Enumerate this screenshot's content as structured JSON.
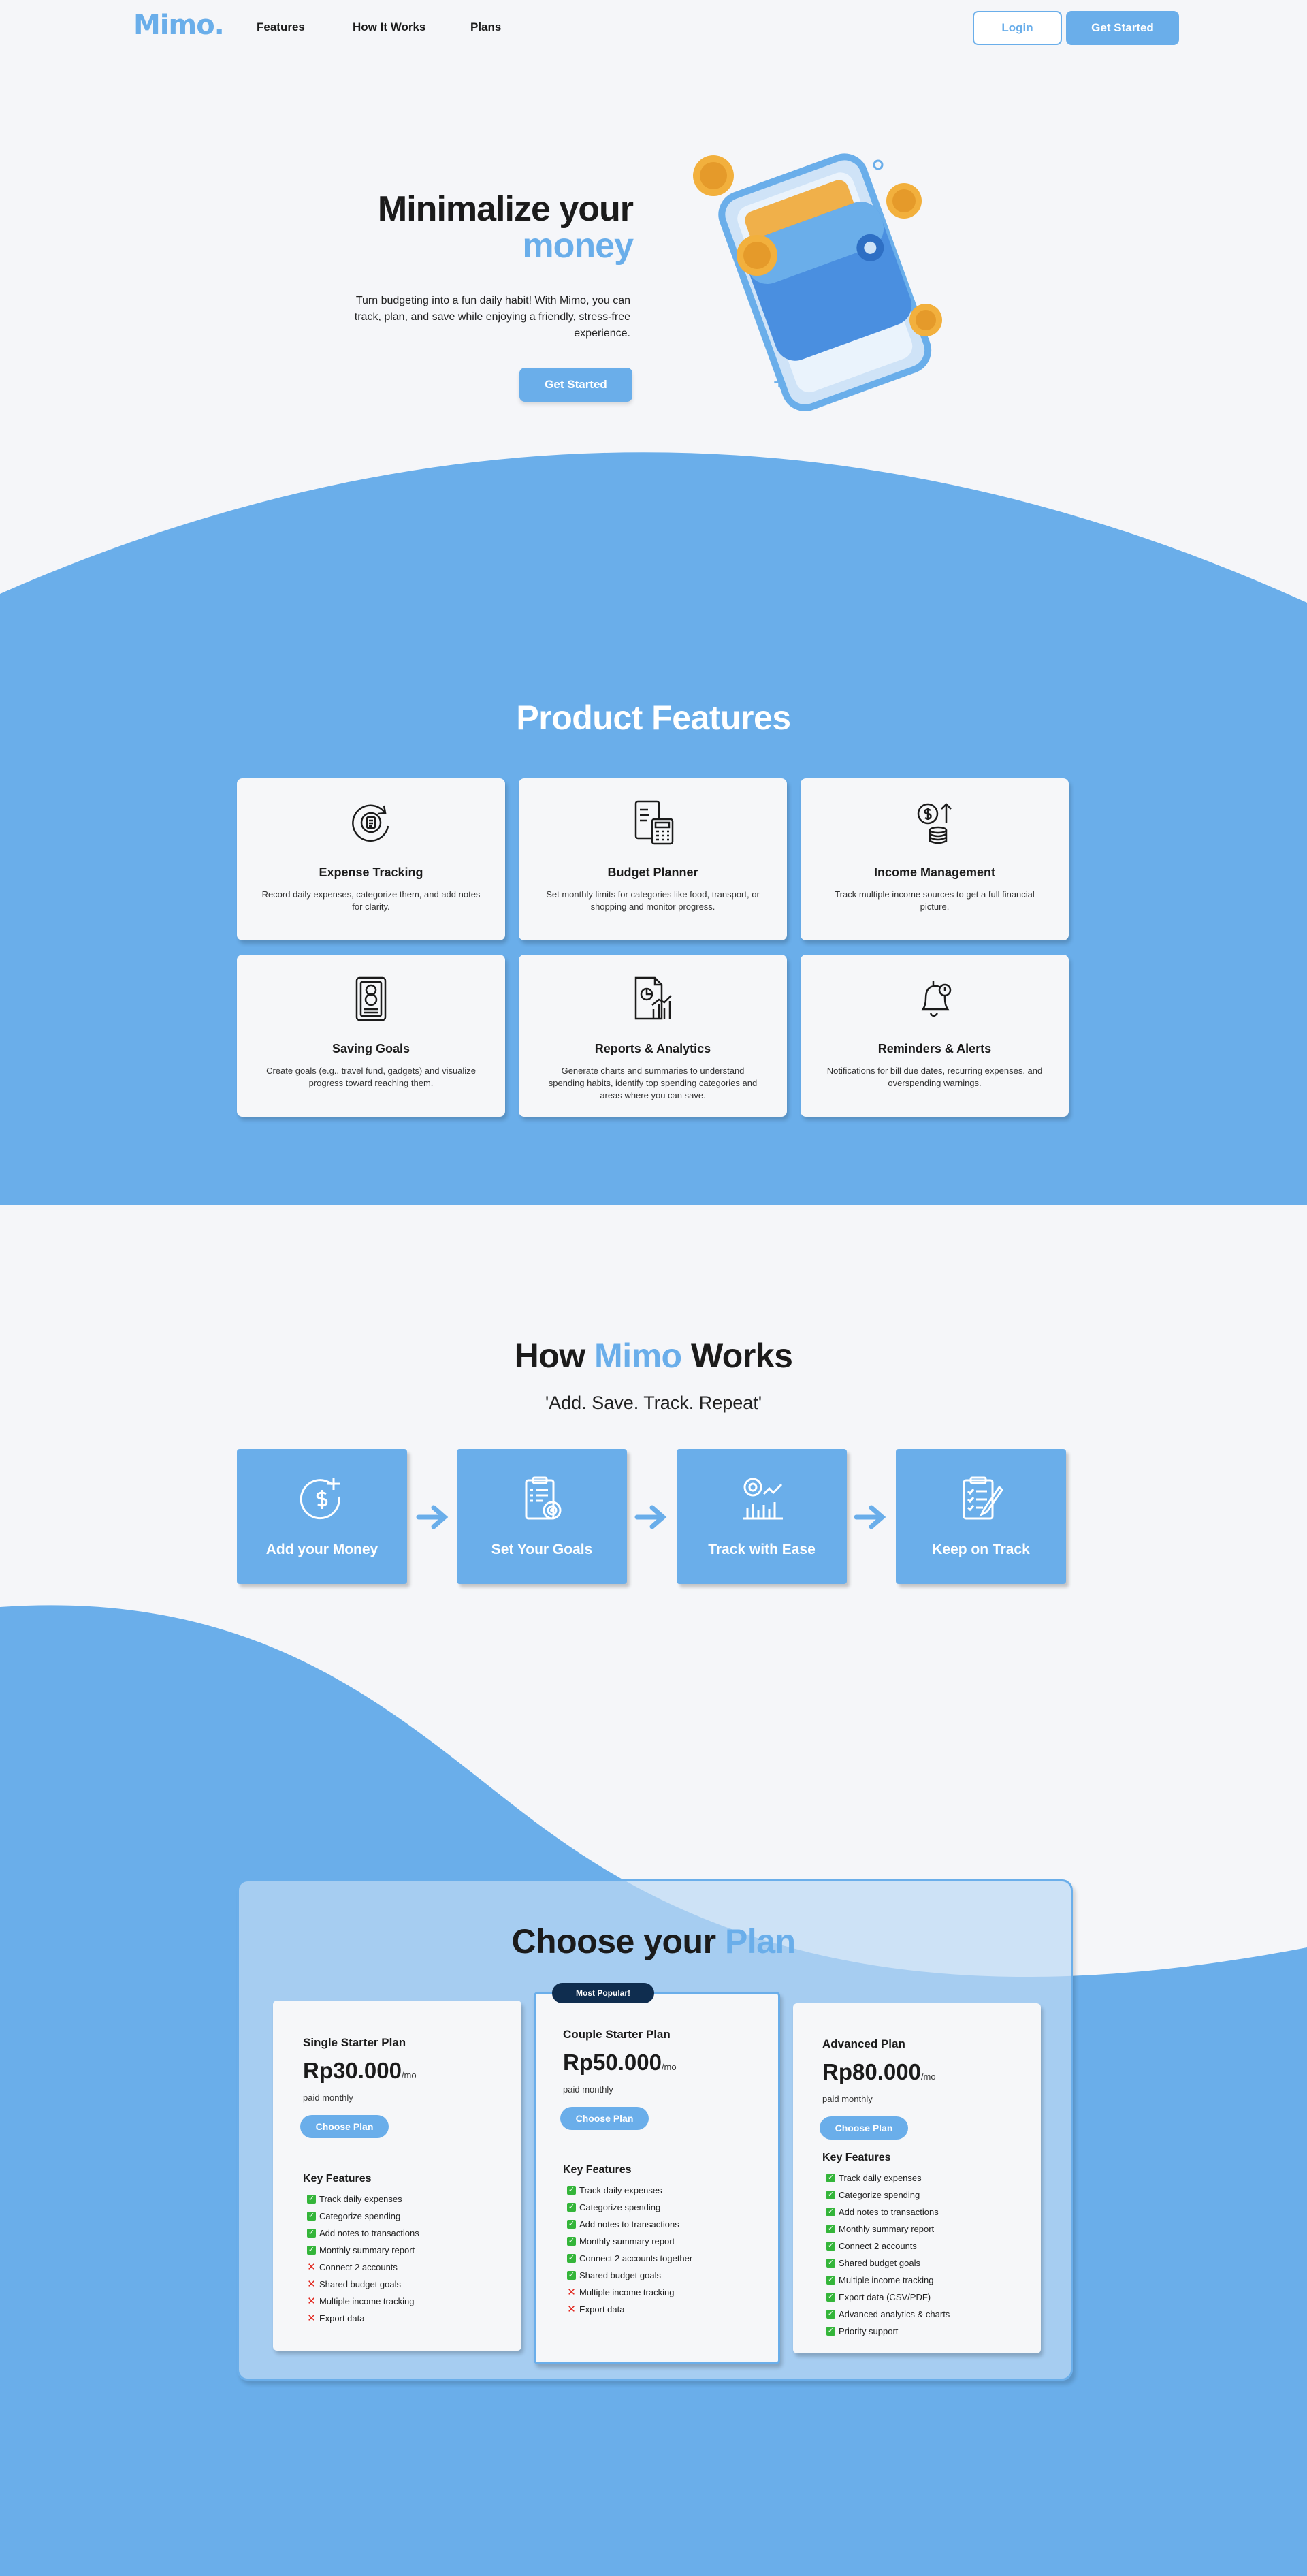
{
  "nav": {
    "logo": "Mimo.",
    "links": [
      "Features",
      "How It Works",
      "Plans"
    ],
    "login": "Login",
    "get_started": "Get Started"
  },
  "hero": {
    "title_line1": "Minimalize your",
    "title_line2": "money",
    "description": "Turn budgeting into a fun daily habit! With Mimo, you can track, plan, and save while enjoying a friendly, stress-free experience.",
    "cta": "Get Started"
  },
  "features": {
    "title": "Product Features",
    "items": [
      {
        "title": "Expense Tracking",
        "desc": "Record daily expenses, categorize them, and add notes for clarity.",
        "icon": "expense-tracking-icon"
      },
      {
        "title": "Budget Planner",
        "desc": "Set monthly limits for categories like food, transport, or shopping and monitor progress.",
        "icon": "budget-planner-icon"
      },
      {
        "title": "Income Management",
        "desc": "Track multiple income sources to get a full financial picture.",
        "icon": "income-management-icon"
      },
      {
        "title": "Saving Goals",
        "desc": "Create goals (e.g., travel fund, gadgets) and visualize progress toward reaching them.",
        "icon": "saving-goals-icon"
      },
      {
        "title": "Reports & Analytics",
        "desc": "Generate charts and summaries to understand spending habits, identify top spending categories and areas where you can save.",
        "icon": "reports-analytics-icon"
      },
      {
        "title": "Reminders & Alerts",
        "desc": "Notifications for bill due dates, recurring expenses, and overspending warnings.",
        "icon": "bell-icon"
      }
    ]
  },
  "how": {
    "title_pre": "How",
    "title_accent": "Mimo",
    "title_post": "Works",
    "subtitle": "'Add. Save. Track. Repeat'",
    "steps": [
      {
        "label": "Add your Money",
        "icon": "add-money-icon"
      },
      {
        "label": "Set Your Goals",
        "icon": "clipboard-target-icon"
      },
      {
        "label": "Track with Ease",
        "icon": "chart-tracking-icon"
      },
      {
        "label": "Keep on Track",
        "icon": "checklist-icon"
      }
    ]
  },
  "plans": {
    "title_pre": "Choose your",
    "title_accent": "Plan",
    "per": "/mo",
    "paid": "paid monthly",
    "choose": "Choose Plan",
    "key_features": "Key Features",
    "popular_badge": "Most Popular!",
    "items": [
      {
        "name": "Single Starter Plan",
        "price": "Rp30.000",
        "features": [
          {
            "t": "Track daily expenses",
            "ok": true
          },
          {
            "t": "Categorize spending",
            "ok": true
          },
          {
            "t": "Add notes to transactions",
            "ok": true
          },
          {
            "t": "Monthly summary report",
            "ok": true
          },
          {
            "t": "Connect 2 accounts",
            "ok": false
          },
          {
            "t": "Shared budget goals",
            "ok": false
          },
          {
            "t": "Multiple income tracking",
            "ok": false
          },
          {
            "t": "Export data",
            "ok": false
          }
        ]
      },
      {
        "name": "Couple Starter Plan",
        "price": "Rp50.000",
        "features": [
          {
            "t": "Track daily expenses",
            "ok": true
          },
          {
            "t": "Categorize spending",
            "ok": true
          },
          {
            "t": "Add notes to transactions",
            "ok": true
          },
          {
            "t": "Monthly summary report",
            "ok": true
          },
          {
            "t": "Connect 2 accounts together",
            "ok": true
          },
          {
            "t": "Shared budget goals",
            "ok": true
          },
          {
            "t": "Multiple income tracking",
            "ok": false
          },
          {
            "t": "Export data",
            "ok": false
          }
        ]
      },
      {
        "name": "Advanced Plan",
        "price": "Rp80.000",
        "features": [
          {
            "t": "Track daily expenses",
            "ok": true
          },
          {
            "t": "Categorize spending",
            "ok": true
          },
          {
            "t": "Add notes to transactions",
            "ok": true
          },
          {
            "t": "Monthly summary report",
            "ok": true
          },
          {
            "t": "Connect 2 accounts",
            "ok": true
          },
          {
            "t": "Shared budget goals",
            "ok": true
          },
          {
            "t": "Multiple income tracking",
            "ok": true
          },
          {
            "t": "Export data (CSV/PDF)",
            "ok": true
          },
          {
            "t": "Advanced analytics & charts",
            "ok": true
          },
          {
            "t": "Priority support",
            "ok": true
          }
        ]
      }
    ]
  },
  "colors": {
    "accent": "#6aaeea",
    "background": "#f5f6f9",
    "badge": "#0f2d4f",
    "check": "#34b53a",
    "cross": "#e0241b"
  }
}
